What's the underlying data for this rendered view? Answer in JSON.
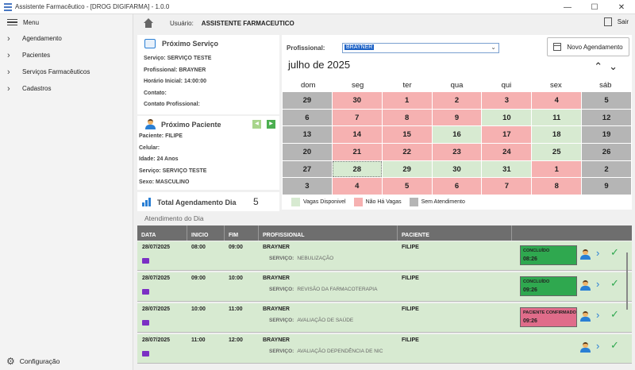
{
  "window": {
    "title": "Assistente Farmacêutico - [DROG DIGIFARMA] - 1.0.0",
    "min_glyph": "—",
    "max_glyph": "☐",
    "close_glyph": "✕"
  },
  "sidebar": {
    "menu_label": "Menu",
    "items": [
      {
        "label": "Agendamento",
        "icon": "chevron-right-icon"
      },
      {
        "label": "Pacientes",
        "icon": "chevron-right-icon"
      },
      {
        "label": "Serviços Farmacêuticos",
        "icon": "chevron-right-icon"
      },
      {
        "label": "Cadastros",
        "icon": "chevron-right-icon"
      }
    ],
    "config_label": "Configuração",
    "chevron": "›",
    "gear": "⚙"
  },
  "header": {
    "user_label": "Usuário:",
    "user_name": "ASSISTENTE FARMACEUTICO",
    "exit_label": "Sair"
  },
  "proximo_servico": {
    "title": "Próximo Serviço",
    "servico_label": "Serviço:",
    "servico": "SERVIÇO TESTE",
    "profissional_label": "Profissional:",
    "profissional": "BRAYNER",
    "horario_label": "Horário Inicial:",
    "horario": "14:00:00",
    "contato_label": "Contato:",
    "contato": "",
    "contato_prof_label": "Contato Profissional:",
    "contato_prof": ""
  },
  "proximo_paciente": {
    "title": "Próximo Paciente",
    "paciente_label": "Paciente:",
    "paciente": "FILIPE",
    "celular_label": "Celular:",
    "celular": "",
    "idade_label": "Idade:",
    "idade": "24 Anos",
    "servico_label": "Serviço:",
    "servico": "SERVIÇO TESTE",
    "sexo_label": "Sexo:",
    "sexo": "MASCULINO",
    "prev_glyph": "◀",
    "next_glyph": "▶"
  },
  "total": {
    "label": "Total Agendamento Dia",
    "value": "5"
  },
  "calendar": {
    "profissional_label": "Profissional:",
    "profissional_value": "BRAYNER",
    "dropdown_glyph": "⌄",
    "novo_label": "Novo Agendamento",
    "month": "julho de 2025",
    "prev_glyph": "⌃",
    "next_glyph": "⌄",
    "weekdays": [
      "dom",
      "seg",
      "ter",
      "qua",
      "qui",
      "sex",
      "sáb"
    ],
    "colors": {
      "gray": "#b5b5b5",
      "red": "#f6b1b1",
      "green": "#d7ead1"
    },
    "days": [
      {
        "d": "29",
        "s": "gray"
      },
      {
        "d": "30",
        "s": "red"
      },
      {
        "d": "1",
        "s": "red"
      },
      {
        "d": "2",
        "s": "red"
      },
      {
        "d": "3",
        "s": "red"
      },
      {
        "d": "4",
        "s": "red"
      },
      {
        "d": "5",
        "s": "gray"
      },
      {
        "d": "6",
        "s": "gray"
      },
      {
        "d": "7",
        "s": "red"
      },
      {
        "d": "8",
        "s": "red"
      },
      {
        "d": "9",
        "s": "red"
      },
      {
        "d": "10",
        "s": "green"
      },
      {
        "d": "11",
        "s": "green"
      },
      {
        "d": "12",
        "s": "gray"
      },
      {
        "d": "13",
        "s": "gray"
      },
      {
        "d": "14",
        "s": "red"
      },
      {
        "d": "15",
        "s": "red"
      },
      {
        "d": "16",
        "s": "green"
      },
      {
        "d": "17",
        "s": "red"
      },
      {
        "d": "18",
        "s": "green"
      },
      {
        "d": "19",
        "s": "gray"
      },
      {
        "d": "20",
        "s": "gray"
      },
      {
        "d": "21",
        "s": "red"
      },
      {
        "d": "22",
        "s": "red"
      },
      {
        "d": "23",
        "s": "red"
      },
      {
        "d": "24",
        "s": "red"
      },
      {
        "d": "25",
        "s": "green"
      },
      {
        "d": "26",
        "s": "gray"
      },
      {
        "d": "27",
        "s": "gray"
      },
      {
        "d": "28",
        "s": "green",
        "sel": true
      },
      {
        "d": "29",
        "s": "green"
      },
      {
        "d": "30",
        "s": "green"
      },
      {
        "d": "31",
        "s": "green"
      },
      {
        "d": "1",
        "s": "red"
      },
      {
        "d": "2",
        "s": "gray"
      },
      {
        "d": "3",
        "s": "gray"
      },
      {
        "d": "4",
        "s": "red"
      },
      {
        "d": "5",
        "s": "red"
      },
      {
        "d": "6",
        "s": "red"
      },
      {
        "d": "7",
        "s": "red"
      },
      {
        "d": "8",
        "s": "red"
      },
      {
        "d": "9",
        "s": "gray"
      }
    ],
    "legend": [
      {
        "label": "Vagas Disponivel",
        "color": "#d7ead1"
      },
      {
        "label": "Não Há Vagas",
        "color": "#f6b1b1"
      },
      {
        "label": "Sem Atendimento",
        "color": "#b5b5b5"
      }
    ]
  },
  "atendimentos": {
    "title": "Atendimento do Dia",
    "columns": [
      "DATA",
      "INICIO",
      "FIM",
      "PROFISSIONAL",
      "PACIENTE"
    ],
    "servico_label": "SERVIÇO:",
    "rows": [
      {
        "data": "28/07/2025",
        "inicio": "08:00",
        "fim": "09:00",
        "profissional": "BRAYNER",
        "servico": "NEBULIZAÇÃO",
        "paciente": "FILIPE",
        "status": "CONCLUÍDO",
        "status_time": "08:26",
        "status_color": "#2fa84f"
      },
      {
        "data": "28/07/2025",
        "inicio": "09:00",
        "fim": "10:00",
        "profissional": "BRAYNER",
        "servico": "REVISÃO DA FARMACOTERAPIA",
        "paciente": "FILIPE",
        "status": "CONCLUÍDO",
        "status_time": "09:26",
        "status_color": "#2fa84f"
      },
      {
        "data": "28/07/2025",
        "inicio": "10:00",
        "fim": "11:00",
        "profissional": "BRAYNER",
        "servico": "AVALIAÇÃO DE SAÚDE",
        "paciente": "FILIPE",
        "status": "PACIENTE CONFIRMADO",
        "status_time": "09:26",
        "status_color": "#e06c8a"
      },
      {
        "data": "28/07/2025",
        "inicio": "11:00",
        "fim": "12:00",
        "profissional": "BRAYNER",
        "servico": "AVALIAÇÃO DEPENDÊNCIA DE NIC",
        "paciente": "FILIPE",
        "status": "",
        "status_time": "",
        "status_color": ""
      }
    ],
    "go_glyph": "›",
    "ok_glyph": "✓"
  }
}
